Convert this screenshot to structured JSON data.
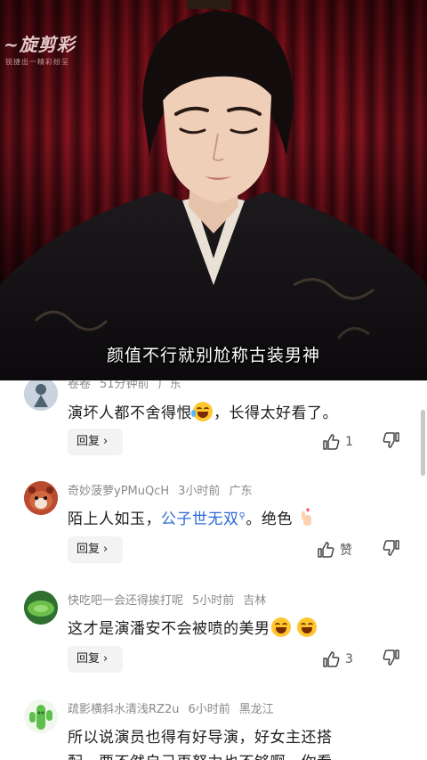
{
  "video": {
    "watermark_title": "~旋剪彩",
    "watermark_sub": "锐捷出一精彩纷呈",
    "subtitle": "颜值不行就别尬称古装男神"
  },
  "comments": [
    {
      "username": "卷卷",
      "time": "51分钟前",
      "location": "广东",
      "text_before": "演坏人都不舍得恨",
      "text_after": "，长得太好看了。",
      "emoji": "laugh-cry-emoji",
      "reply_label": "回复",
      "likes": "1",
      "avatar_colors": {
        "bg": "#b9c7d6",
        "fg": "#4f6272"
      }
    },
    {
      "username": "奇妙菠萝yPMuQcH",
      "time": "3小时前",
      "location": "广东",
      "text_before": "陌上人如玉，",
      "link": "公子世无双",
      "text_after": "。绝色",
      "emoji": "finger-heart-emoji",
      "reply_label": "回复",
      "likes": "赞",
      "avatar_colors": {
        "bg": "#c4553a",
        "fg": "#f4e4d8"
      }
    },
    {
      "username": "快吃吧一会还得挨打呢",
      "time": "5小时前",
      "location": "吉林",
      "text_before": "这才是演潘安不会被喷的美男",
      "emoji": "grinning-emoji",
      "reply_label": "回复",
      "likes": "3",
      "avatar_colors": {
        "bg": "#3d8a3a",
        "fg": "#8fd06b"
      }
    },
    {
      "username": "疏影横斜水清浅RZ2u",
      "time": "6小时前",
      "location": "黑龙江",
      "text_line1": "所以说演员也得有好导演，好女主还搭",
      "text_line2": "配，要不然自己再努力也不够啊，你看",
      "avatar_colors": {
        "bg": "#5ec04c",
        "fg": "#2c6a25"
      }
    }
  ]
}
